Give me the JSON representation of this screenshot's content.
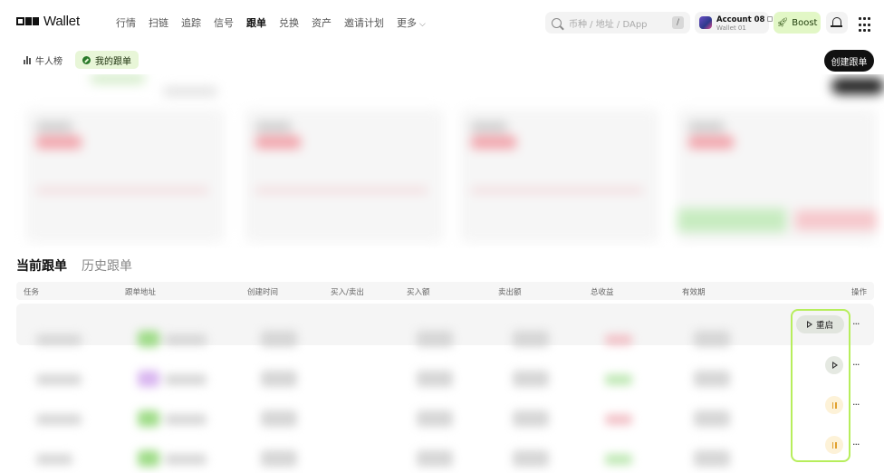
{
  "app": {
    "logo_text": "Wallet"
  },
  "nav": {
    "items": [
      "行情",
      "扫链",
      "追踪",
      "信号",
      "跟单",
      "兑换",
      "资产",
      "邀请计划",
      "更多"
    ],
    "active": "跟单"
  },
  "search": {
    "placeholder": "币种 / 地址 / DApp",
    "shortcut": "/"
  },
  "account": {
    "name": "Account 08",
    "wallet": "Wallet 01"
  },
  "boost": {
    "label": "Boost",
    "color": "#e2f7c6"
  },
  "subtabs": [
    {
      "label": "牛人榜",
      "active": false
    },
    {
      "label": "我的跟单",
      "active": true
    }
  ],
  "create_button": {
    "label": "创建跟单"
  },
  "section_tabs": [
    {
      "label": "当前跟单",
      "active": true
    },
    {
      "label": "历史跟单",
      "active": false
    }
  ],
  "table": {
    "columns": [
      "任务",
      "跟单地址",
      "创建时间",
      "买入/卖出",
      "买入额",
      "卖出额",
      "总收益",
      "有效期",
      "操作"
    ],
    "rows": [
      {
        "action": "restart",
        "action_label": "重启"
      },
      {
        "action": "start"
      },
      {
        "action": "pause"
      },
      {
        "action": "pause"
      }
    ]
  },
  "colors": {
    "highlight_border": "#b7ee5c",
    "pause_accent": "#e1a12e"
  }
}
